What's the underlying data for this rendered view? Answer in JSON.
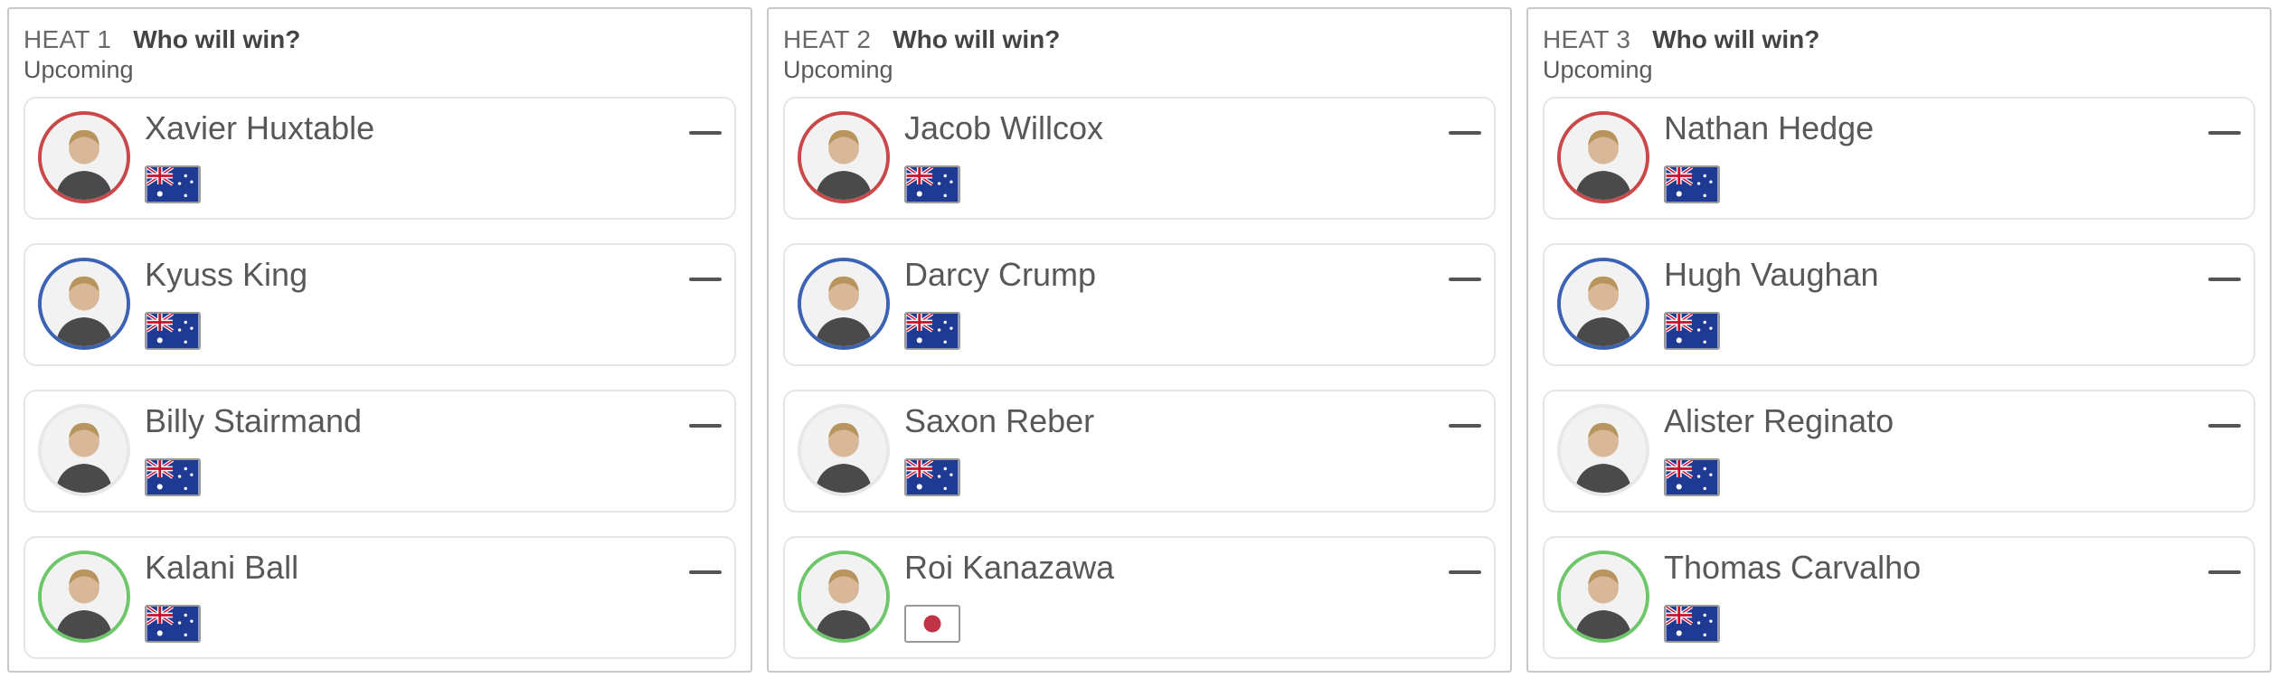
{
  "heats": [
    {
      "label": "HEAT 1",
      "question": "Who will win?",
      "status": "Upcoming",
      "surfers": [
        {
          "name": "Xavier Huxtable",
          "country": "australia",
          "jersey": "red",
          "score": "—"
        },
        {
          "name": "Kyuss King",
          "country": "australia",
          "jersey": "blue",
          "score": "—"
        },
        {
          "name": "Billy Stairmand",
          "country": "australia",
          "jersey": "white",
          "score": "—"
        },
        {
          "name": "Kalani Ball",
          "country": "australia",
          "jersey": "green",
          "score": "—"
        }
      ]
    },
    {
      "label": "HEAT 2",
      "question": "Who will win?",
      "status": "Upcoming",
      "surfers": [
        {
          "name": "Jacob Willcox",
          "country": "australia",
          "jersey": "red",
          "score": "—"
        },
        {
          "name": "Darcy Crump",
          "country": "australia",
          "jersey": "blue",
          "score": "—"
        },
        {
          "name": "Saxon Reber",
          "country": "australia",
          "jersey": "white",
          "score": "—"
        },
        {
          "name": "Roi Kanazawa",
          "country": "japan",
          "jersey": "green",
          "score": "—"
        }
      ]
    },
    {
      "label": "HEAT 3",
      "question": "Who will win?",
      "status": "Upcoming",
      "surfers": [
        {
          "name": "Nathan Hedge",
          "country": "australia",
          "jersey": "red",
          "score": "—"
        },
        {
          "name": "Hugh Vaughan",
          "country": "australia",
          "jersey": "blue",
          "score": "—"
        },
        {
          "name": "Alister Reginato",
          "country": "australia",
          "jersey": "white",
          "score": "—"
        },
        {
          "name": "Thomas Carvalho",
          "country": "australia",
          "jersey": "green",
          "score": "—"
        }
      ]
    }
  ],
  "colors": {
    "jersey_red": "#c9484a",
    "jersey_blue": "#3b62b3",
    "jersey_white": "#e8e8e8",
    "jersey_green": "#6ec66a",
    "australia_blue": "#1f3a93",
    "japan_red": "#c23347"
  }
}
